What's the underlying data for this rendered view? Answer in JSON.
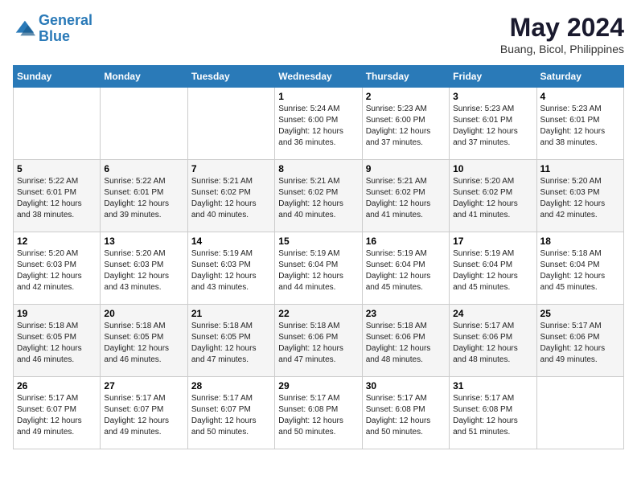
{
  "header": {
    "logo_line1": "General",
    "logo_line2": "Blue",
    "month_year": "May 2024",
    "location": "Buang, Bicol, Philippines"
  },
  "days_of_week": [
    "Sunday",
    "Monday",
    "Tuesday",
    "Wednesday",
    "Thursday",
    "Friday",
    "Saturday"
  ],
  "weeks": [
    [
      {
        "day": "",
        "sunrise": "",
        "sunset": "",
        "daylight": ""
      },
      {
        "day": "",
        "sunrise": "",
        "sunset": "",
        "daylight": ""
      },
      {
        "day": "",
        "sunrise": "",
        "sunset": "",
        "daylight": ""
      },
      {
        "day": "1",
        "sunrise": "Sunrise: 5:24 AM",
        "sunset": "Sunset: 6:00 PM",
        "daylight": "Daylight: 12 hours and 36 minutes."
      },
      {
        "day": "2",
        "sunrise": "Sunrise: 5:23 AM",
        "sunset": "Sunset: 6:00 PM",
        "daylight": "Daylight: 12 hours and 37 minutes."
      },
      {
        "day": "3",
        "sunrise": "Sunrise: 5:23 AM",
        "sunset": "Sunset: 6:01 PM",
        "daylight": "Daylight: 12 hours and 37 minutes."
      },
      {
        "day": "4",
        "sunrise": "Sunrise: 5:23 AM",
        "sunset": "Sunset: 6:01 PM",
        "daylight": "Daylight: 12 hours and 38 minutes."
      }
    ],
    [
      {
        "day": "5",
        "sunrise": "Sunrise: 5:22 AM",
        "sunset": "Sunset: 6:01 PM",
        "daylight": "Daylight: 12 hours and 38 minutes."
      },
      {
        "day": "6",
        "sunrise": "Sunrise: 5:22 AM",
        "sunset": "Sunset: 6:01 PM",
        "daylight": "Daylight: 12 hours and 39 minutes."
      },
      {
        "day": "7",
        "sunrise": "Sunrise: 5:21 AM",
        "sunset": "Sunset: 6:02 PM",
        "daylight": "Daylight: 12 hours and 40 minutes."
      },
      {
        "day": "8",
        "sunrise": "Sunrise: 5:21 AM",
        "sunset": "Sunset: 6:02 PM",
        "daylight": "Daylight: 12 hours and 40 minutes."
      },
      {
        "day": "9",
        "sunrise": "Sunrise: 5:21 AM",
        "sunset": "Sunset: 6:02 PM",
        "daylight": "Daylight: 12 hours and 41 minutes."
      },
      {
        "day": "10",
        "sunrise": "Sunrise: 5:20 AM",
        "sunset": "Sunset: 6:02 PM",
        "daylight": "Daylight: 12 hours and 41 minutes."
      },
      {
        "day": "11",
        "sunrise": "Sunrise: 5:20 AM",
        "sunset": "Sunset: 6:03 PM",
        "daylight": "Daylight: 12 hours and 42 minutes."
      }
    ],
    [
      {
        "day": "12",
        "sunrise": "Sunrise: 5:20 AM",
        "sunset": "Sunset: 6:03 PM",
        "daylight": "Daylight: 12 hours and 42 minutes."
      },
      {
        "day": "13",
        "sunrise": "Sunrise: 5:20 AM",
        "sunset": "Sunset: 6:03 PM",
        "daylight": "Daylight: 12 hours and 43 minutes."
      },
      {
        "day": "14",
        "sunrise": "Sunrise: 5:19 AM",
        "sunset": "Sunset: 6:03 PM",
        "daylight": "Daylight: 12 hours and 43 minutes."
      },
      {
        "day": "15",
        "sunrise": "Sunrise: 5:19 AM",
        "sunset": "Sunset: 6:04 PM",
        "daylight": "Daylight: 12 hours and 44 minutes."
      },
      {
        "day": "16",
        "sunrise": "Sunrise: 5:19 AM",
        "sunset": "Sunset: 6:04 PM",
        "daylight": "Daylight: 12 hours and 45 minutes."
      },
      {
        "day": "17",
        "sunrise": "Sunrise: 5:19 AM",
        "sunset": "Sunset: 6:04 PM",
        "daylight": "Daylight: 12 hours and 45 minutes."
      },
      {
        "day": "18",
        "sunrise": "Sunrise: 5:18 AM",
        "sunset": "Sunset: 6:04 PM",
        "daylight": "Daylight: 12 hours and 45 minutes."
      }
    ],
    [
      {
        "day": "19",
        "sunrise": "Sunrise: 5:18 AM",
        "sunset": "Sunset: 6:05 PM",
        "daylight": "Daylight: 12 hours and 46 minutes."
      },
      {
        "day": "20",
        "sunrise": "Sunrise: 5:18 AM",
        "sunset": "Sunset: 6:05 PM",
        "daylight": "Daylight: 12 hours and 46 minutes."
      },
      {
        "day": "21",
        "sunrise": "Sunrise: 5:18 AM",
        "sunset": "Sunset: 6:05 PM",
        "daylight": "Daylight: 12 hours and 47 minutes."
      },
      {
        "day": "22",
        "sunrise": "Sunrise: 5:18 AM",
        "sunset": "Sunset: 6:06 PM",
        "daylight": "Daylight: 12 hours and 47 minutes."
      },
      {
        "day": "23",
        "sunrise": "Sunrise: 5:18 AM",
        "sunset": "Sunset: 6:06 PM",
        "daylight": "Daylight: 12 hours and 48 minutes."
      },
      {
        "day": "24",
        "sunrise": "Sunrise: 5:17 AM",
        "sunset": "Sunset: 6:06 PM",
        "daylight": "Daylight: 12 hours and 48 minutes."
      },
      {
        "day": "25",
        "sunrise": "Sunrise: 5:17 AM",
        "sunset": "Sunset: 6:06 PM",
        "daylight": "Daylight: 12 hours and 49 minutes."
      }
    ],
    [
      {
        "day": "26",
        "sunrise": "Sunrise: 5:17 AM",
        "sunset": "Sunset: 6:07 PM",
        "daylight": "Daylight: 12 hours and 49 minutes."
      },
      {
        "day": "27",
        "sunrise": "Sunrise: 5:17 AM",
        "sunset": "Sunset: 6:07 PM",
        "daylight": "Daylight: 12 hours and 49 minutes."
      },
      {
        "day": "28",
        "sunrise": "Sunrise: 5:17 AM",
        "sunset": "Sunset: 6:07 PM",
        "daylight": "Daylight: 12 hours and 50 minutes."
      },
      {
        "day": "29",
        "sunrise": "Sunrise: 5:17 AM",
        "sunset": "Sunset: 6:08 PM",
        "daylight": "Daylight: 12 hours and 50 minutes."
      },
      {
        "day": "30",
        "sunrise": "Sunrise: 5:17 AM",
        "sunset": "Sunset: 6:08 PM",
        "daylight": "Daylight: 12 hours and 50 minutes."
      },
      {
        "day": "31",
        "sunrise": "Sunrise: 5:17 AM",
        "sunset": "Sunset: 6:08 PM",
        "daylight": "Daylight: 12 hours and 51 minutes."
      },
      {
        "day": "",
        "sunrise": "",
        "sunset": "",
        "daylight": ""
      }
    ]
  ]
}
